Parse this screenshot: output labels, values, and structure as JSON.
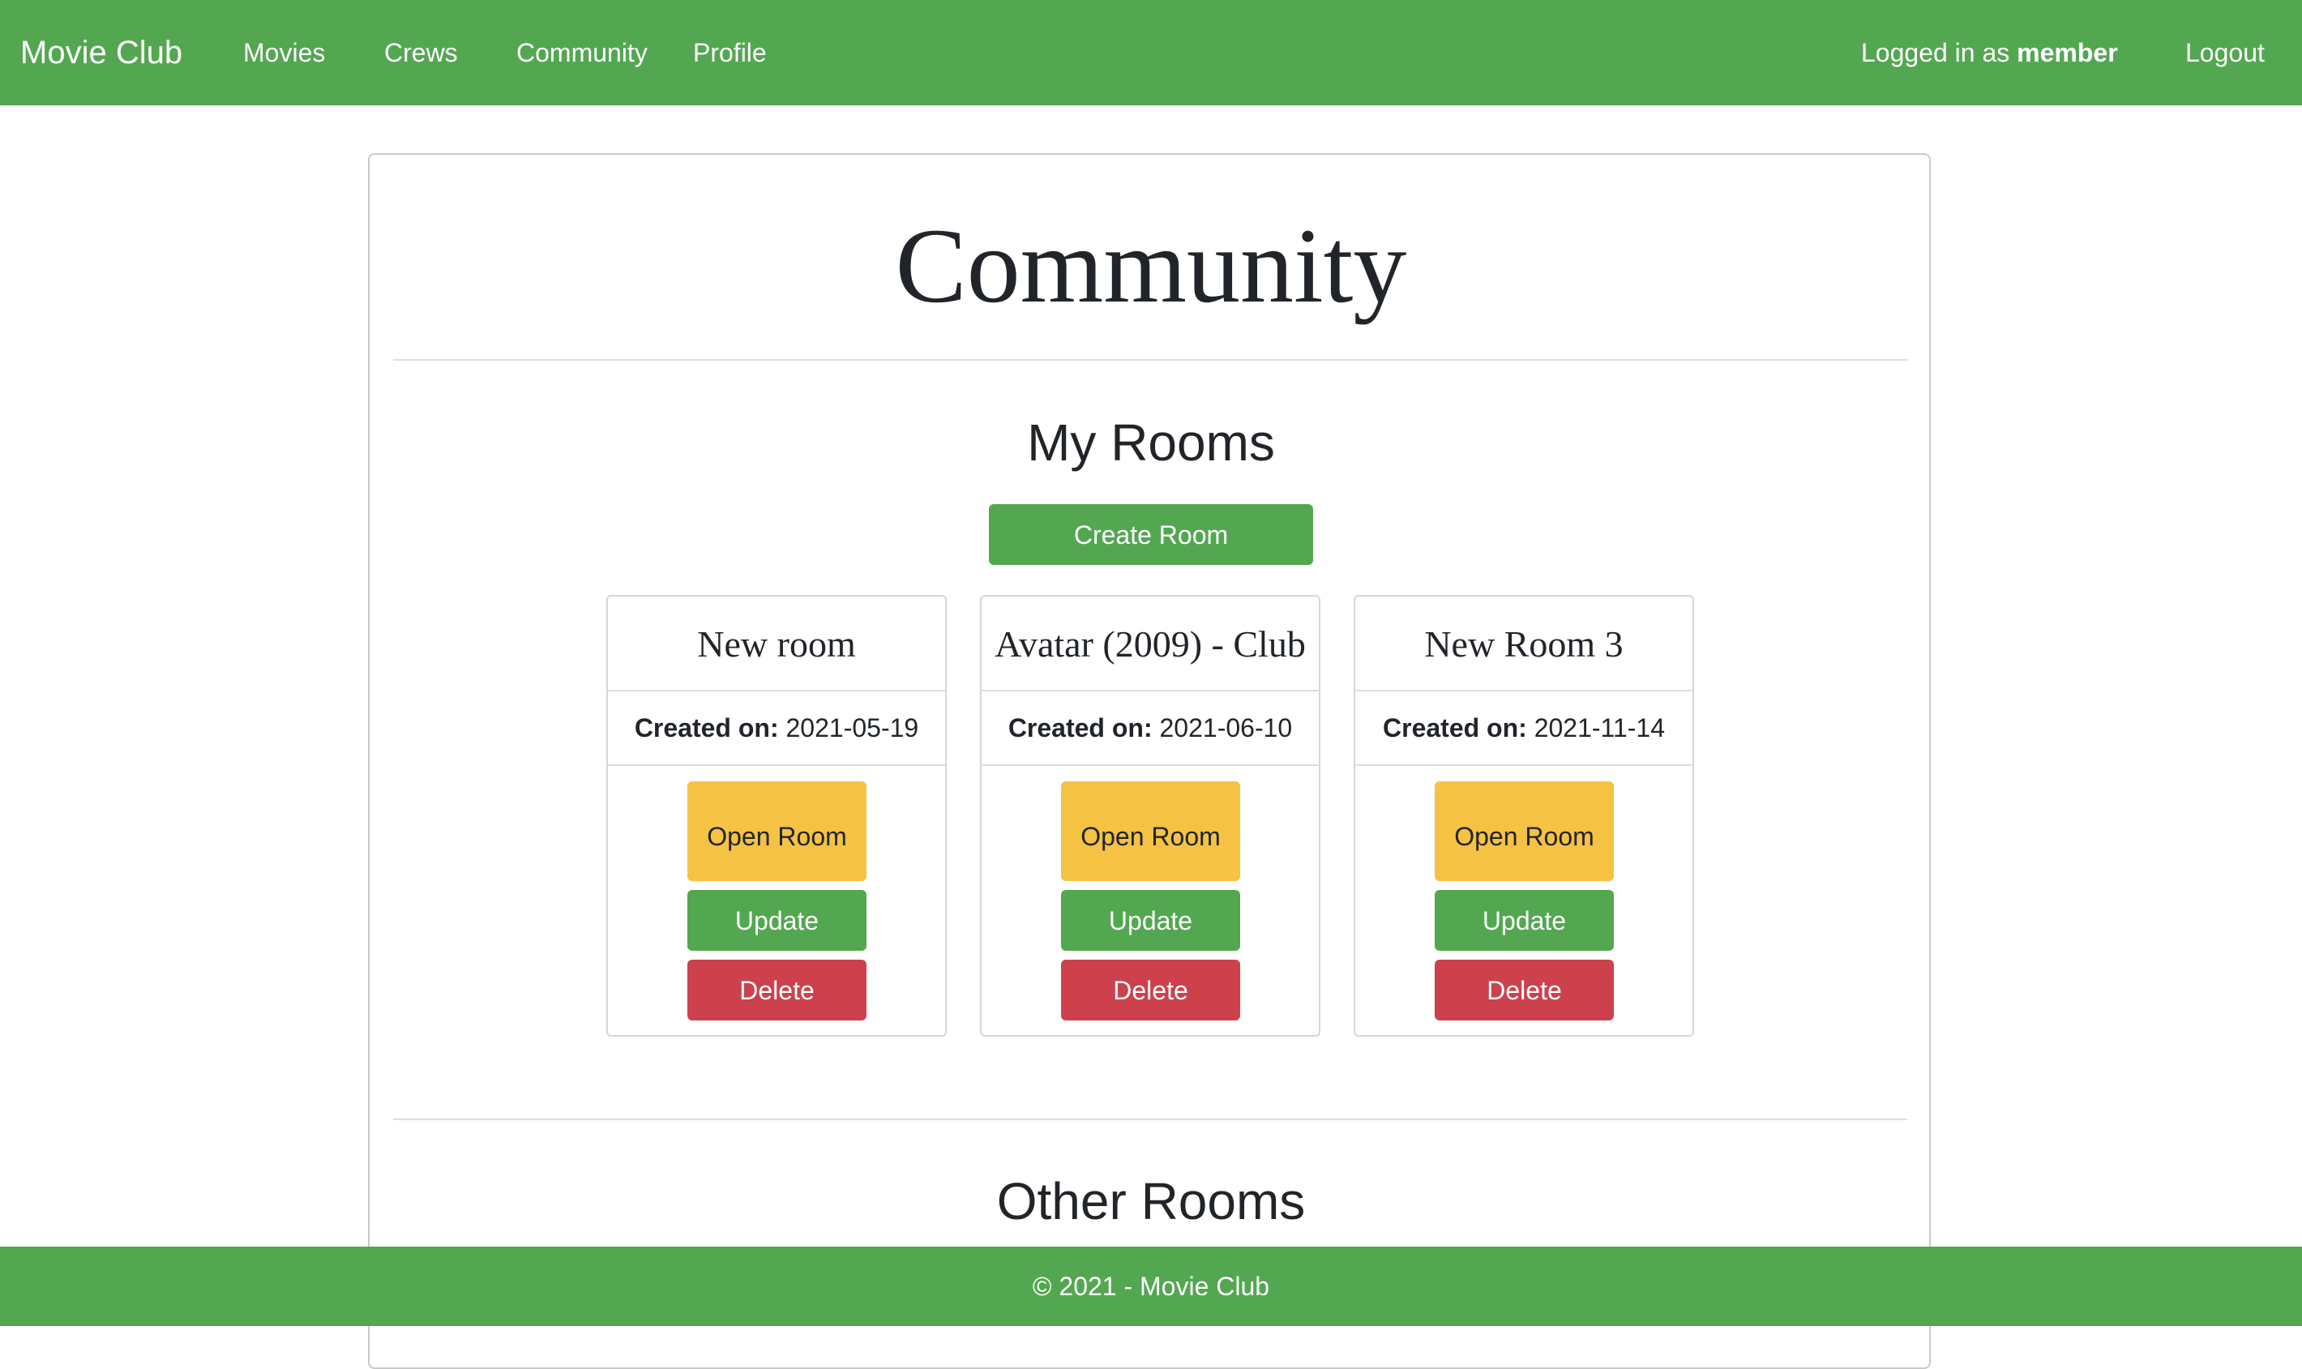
{
  "navbar": {
    "brand": "Movie Club",
    "links": [
      {
        "label": "Movies"
      },
      {
        "label": "Crews"
      },
      {
        "label": "Community"
      },
      {
        "label": "Profile"
      }
    ],
    "login_prefix": "Logged in as ",
    "username": "member",
    "logout_label": "Logout"
  },
  "page": {
    "title": "Community"
  },
  "my_rooms": {
    "title": "My Rooms",
    "create_label": "Create Room",
    "created_label": "Created on:",
    "rooms": [
      {
        "name": "New room",
        "created_on": "2021-05-19",
        "open_label": "Open Room",
        "update_label": "Update",
        "delete_label": "Delete"
      },
      {
        "name": "Avatar (2009) - Club",
        "created_on": "2021-06-10",
        "open_label": "Open Room",
        "update_label": "Update",
        "delete_label": "Delete"
      },
      {
        "name": "New Room 3",
        "created_on": "2021-11-14",
        "open_label": "Open Room",
        "update_label": "Update",
        "delete_label": "Delete"
      }
    ]
  },
  "other_rooms": {
    "title": "Other Rooms"
  },
  "footer": {
    "text": "© 2021 - Movie Club"
  },
  "colors": {
    "primary_green": "#53a751",
    "warning_yellow": "#f6c244",
    "danger_red": "#cd414c"
  }
}
